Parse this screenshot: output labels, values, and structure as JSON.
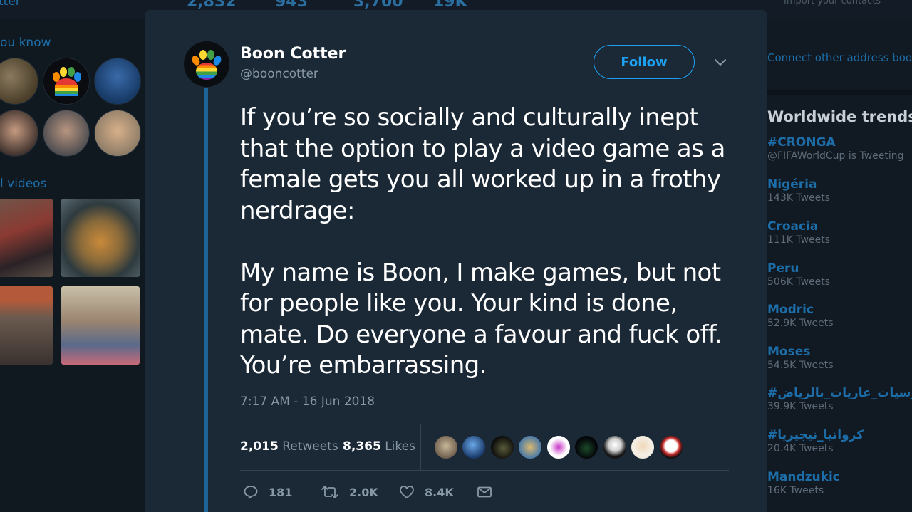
{
  "background": {
    "brand_text": "tter",
    "top_stats": [
      "2,832",
      "943",
      "3,700",
      "19K"
    ],
    "top_right_text": "Import your contacts",
    "left": {
      "people_title": "ou know",
      "videos_title": "l videos"
    },
    "right": {
      "connect_text": "Connect other address book",
      "trends_title": "Worldwide trends",
      "trends": [
        {
          "name": "#CRONGA",
          "count": "@FIFAWorldCup is Tweeting"
        },
        {
          "name": "Nigéria",
          "count": "143K Tweets"
        },
        {
          "name": "Croacia",
          "count": "111K Tweets"
        },
        {
          "name": "Peru",
          "count": "506K Tweets"
        },
        {
          "name": "Modric",
          "count": "52.9K Tweets"
        },
        {
          "name": "Moses",
          "count": "54.5K Tweets"
        },
        {
          "name": "#روسيات_عاريات_بالرياض",
          "count": "39.9K Tweets"
        },
        {
          "name": "#كرواتيا_نيجيريا",
          "count": "20.4K Tweets"
        },
        {
          "name": "Mandzukic",
          "count": "16K Tweets"
        }
      ]
    }
  },
  "tweet": {
    "display_name": "Boon Cotter",
    "username": "@booncotter",
    "follow_label": "Follow",
    "text_paragraph_1": "If you’re so socially and culturally inept that the option to play a video game as a female gets you all worked up in a frothy nerdrage:",
    "text_paragraph_2": "My name is Boon, I make games, but not for people like you. Your kind is done, mate. Do everyone a favour and fuck off. You’re embarrassing.",
    "timestamp": "7:17 AM - 16 Jun 2018",
    "retweets_count": "2,015",
    "retweets_label": "Retweets",
    "likes_count": "8,365",
    "likes_label": "Likes",
    "actions": {
      "reply_count": "181",
      "retweet_count": "2.0K",
      "like_count": "8.4K"
    }
  },
  "colors": {
    "accent": "#1da1f2",
    "modal_bg": "#1b2836",
    "muted_text": "#8899a6"
  }
}
